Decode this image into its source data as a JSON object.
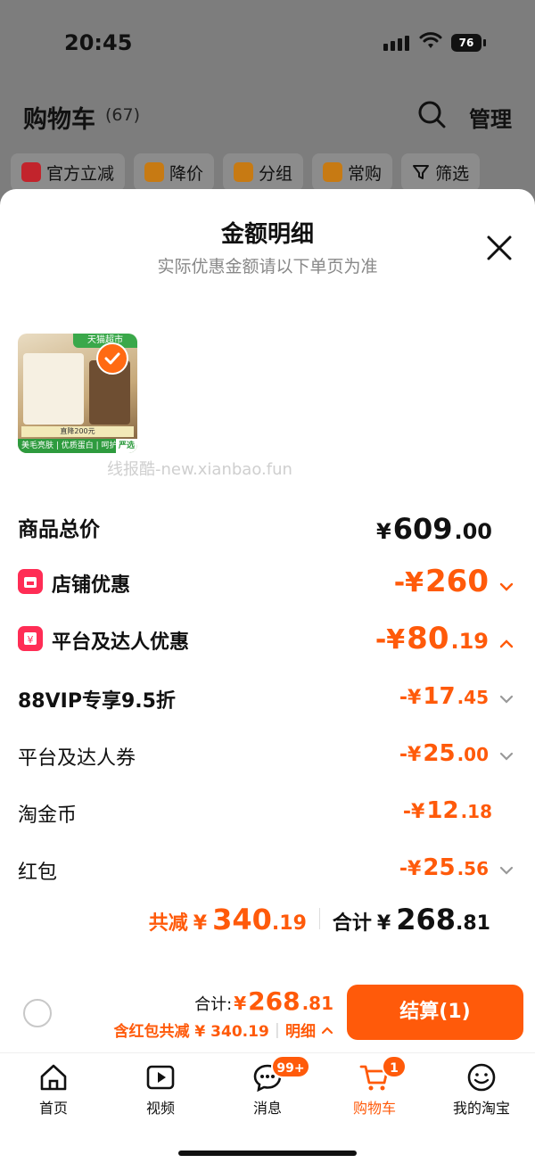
{
  "status": {
    "time": "20:45",
    "battery": "76"
  },
  "page": {
    "title": "购物车",
    "count": "(67)",
    "manage": "管理"
  },
  "filters": [
    "官方立减",
    "降价",
    "分组",
    "常购",
    "筛选"
  ],
  "sheet": {
    "title": "金额明细",
    "subtitle": "实际优惠金额请以下单页为准",
    "product_tags": {
      "top": "天猫超市",
      "bar1": "直降200元",
      "bar2": "美毛亮肤 | 优质蛋白 | 呵护心脏",
      "badge": "严选"
    },
    "watermark": "线报酷-new.xianbao.fun"
  },
  "rows": {
    "total": {
      "label": "商品总价",
      "yen": "¥",
      "int": "609",
      "dec": ".00"
    },
    "shop": {
      "label": "店铺优惠",
      "prefix": "-¥",
      "int": "260",
      "dec": ""
    },
    "platform": {
      "label": "平台及达人优惠",
      "prefix": "-¥",
      "int": "80",
      "dec": ".19"
    },
    "vip": {
      "label": "88VIP专享9.5折",
      "prefix": "-¥",
      "int": "17",
      "dec": ".45"
    },
    "coupon": {
      "label": "平台及达人券",
      "prefix": "-¥",
      "int": "25",
      "dec": ".00"
    },
    "coin": {
      "label": "淘金币",
      "prefix": "-¥",
      "int": "12",
      "dec": ".18"
    },
    "redpacket": {
      "label": "红包",
      "prefix": "-¥",
      "int": "25",
      "dec": ".56"
    }
  },
  "summary": {
    "reduce_label": "共减",
    "reduce_yen": "¥",
    "reduce_int": "340",
    "reduce_dec": ".19",
    "total_label": "合计",
    "total_yen": "¥",
    "total_int": "268",
    "total_dec": ".81"
  },
  "checkout": {
    "total_label": "合计:",
    "yen": "¥",
    "int": "268",
    "dec": ".81",
    "note": "含红包共减 ¥ 340.19",
    "detail": "明细",
    "button": "结算(1)"
  },
  "tabs": [
    {
      "label": "首页",
      "icon": "home-icon"
    },
    {
      "label": "视频",
      "icon": "video-icon"
    },
    {
      "label": "消息",
      "icon": "message-icon",
      "badge": "99+"
    },
    {
      "label": "购物车",
      "icon": "cart-icon",
      "badge": "1"
    },
    {
      "label": "我的淘宝",
      "icon": "profile-icon"
    }
  ],
  "colors": {
    "accent": "#ff5a0a",
    "danger": "#ff2d55",
    "overlay": "#7d7d7d"
  }
}
